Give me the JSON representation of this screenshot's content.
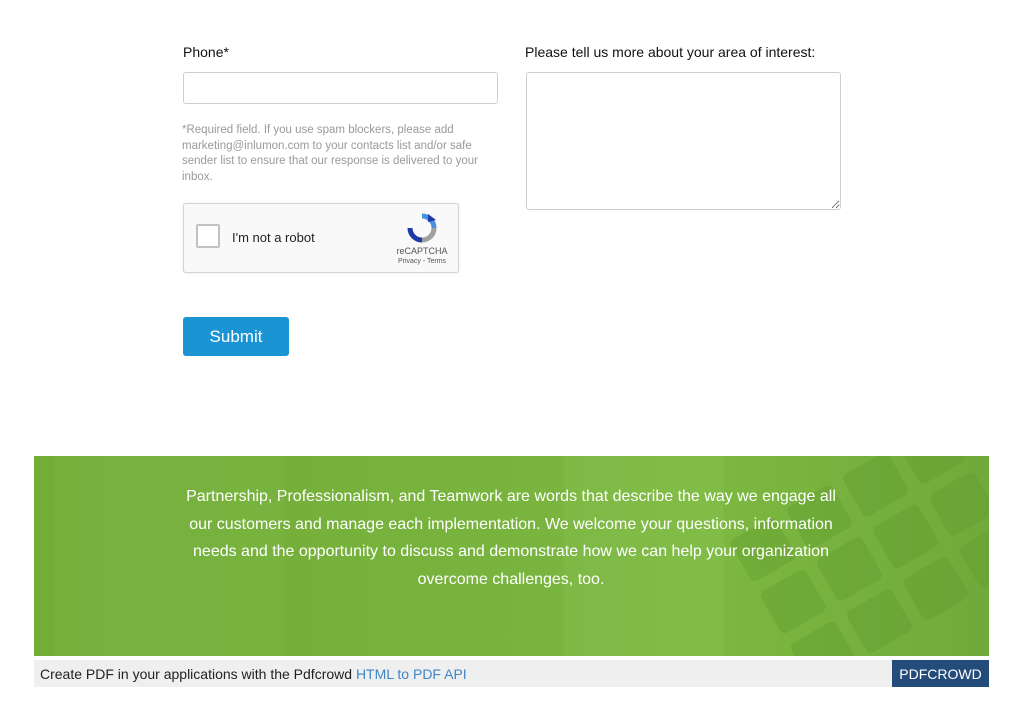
{
  "form": {
    "phone_label": "Phone*",
    "phone_value": "",
    "interest_label": "Please tell us more about your area of interest:",
    "interest_value": "",
    "note": "*Required field. If you use spam blockers, please add marketing@inlumon.com to your contacts list and/or safe sender list to ensure that our response is delivered to your inbox.",
    "submit_label": "Submit"
  },
  "recaptcha": {
    "checkbox_label": "I'm not a robot",
    "brand": "reCAPTCHA",
    "terms": "Privacy - Terms",
    "logo_icon": "recaptcha-logo-icon"
  },
  "banner": {
    "text": "Partnership, Professionalism, and Teamwork are words that describe the way we engage all our customers and manage each implementation. We welcome your questions, information needs and the opportunity to discuss and demonstrate how we can help your organization overcome challenges, too."
  },
  "footer": {
    "text": "Create PDF in your applications with the Pdfcrowd ",
    "link": "HTML to PDF API",
    "badge": "PDFCROWD"
  },
  "colors": {
    "accent": "#1b94d4",
    "banner_green": "#7ab73f",
    "badge": "#234c7b"
  }
}
